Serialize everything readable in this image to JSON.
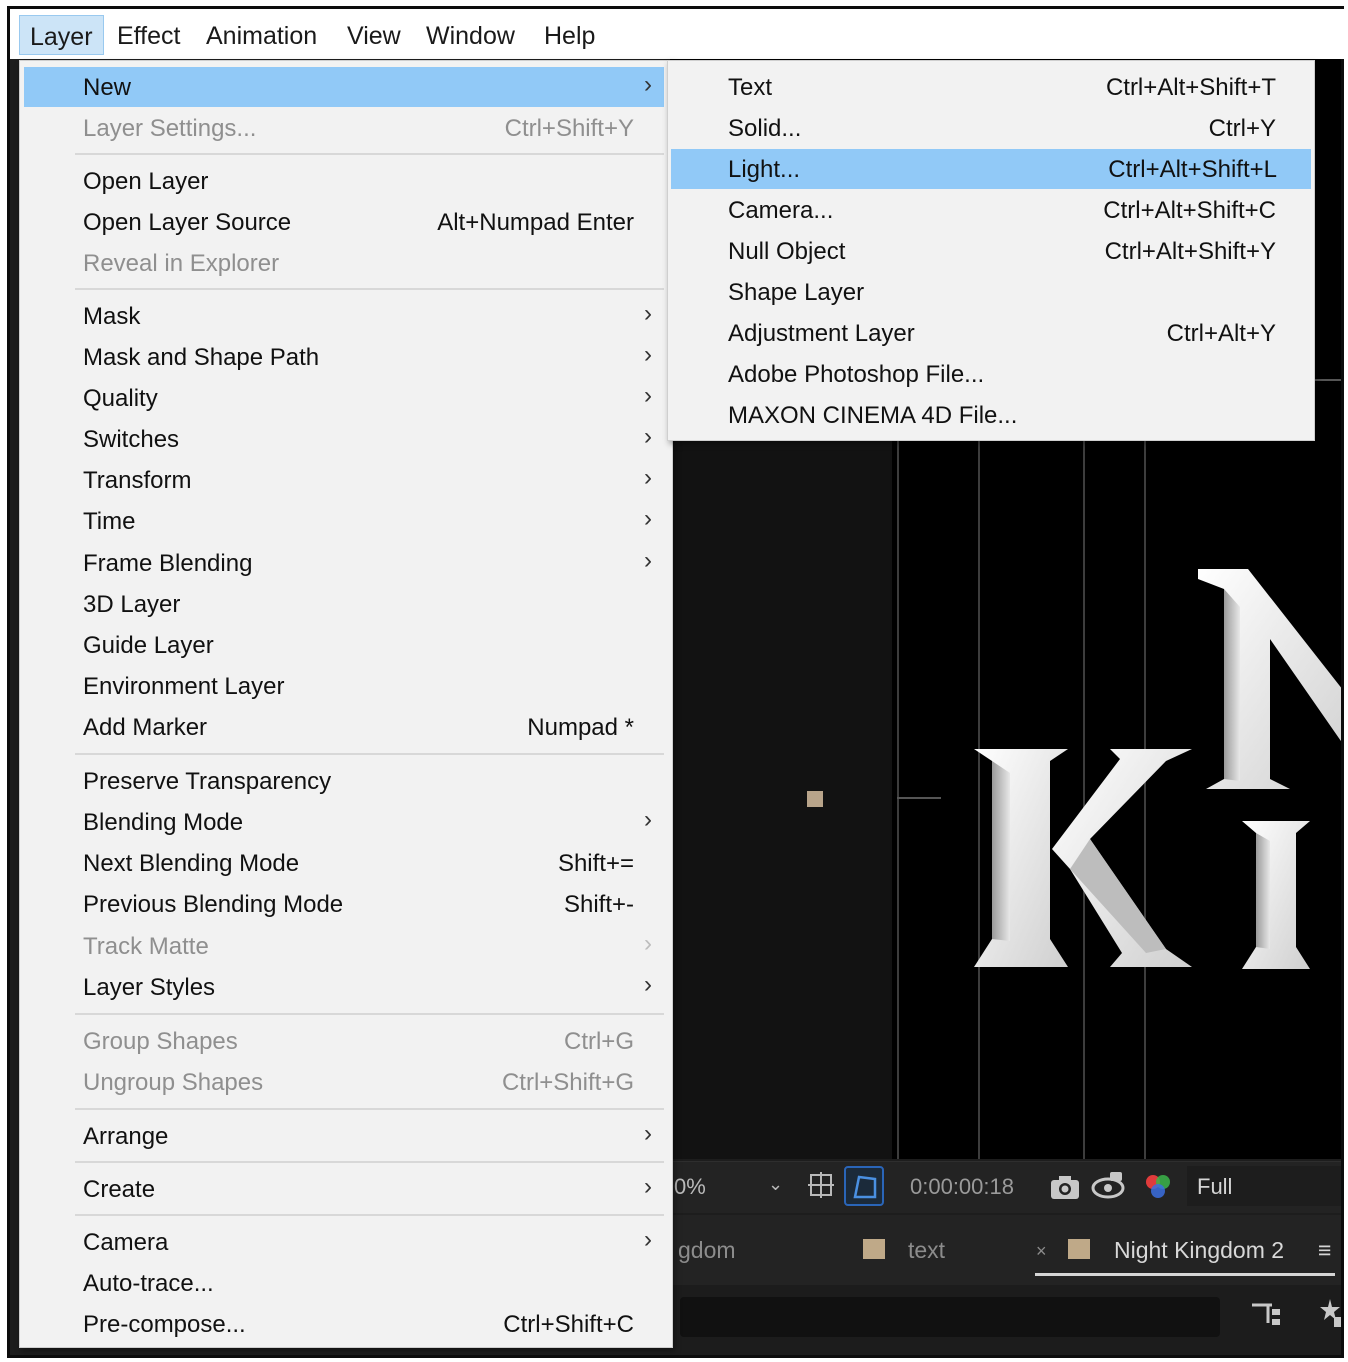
{
  "menubar": {
    "items": [
      "Layer",
      "Effect",
      "Animation",
      "View",
      "Window",
      "Help"
    ],
    "active": "Layer"
  },
  "layer_menu": {
    "items": [
      {
        "label": "New",
        "submenu": true,
        "highlighted": true
      },
      {
        "label": "Layer Settings...",
        "shortcut": "Ctrl+Shift+Y",
        "disabled": true
      },
      {
        "label": "Open Layer"
      },
      {
        "label": "Open Layer Source",
        "shortcut": "Alt+Numpad Enter"
      },
      {
        "label": "Reveal in Explorer",
        "disabled": true
      },
      {
        "label": "Mask",
        "submenu": true
      },
      {
        "label": "Mask and Shape Path",
        "submenu": true
      },
      {
        "label": "Quality",
        "submenu": true
      },
      {
        "label": "Switches",
        "submenu": true
      },
      {
        "label": "Transform",
        "submenu": true
      },
      {
        "label": "Time",
        "submenu": true
      },
      {
        "label": "Frame Blending",
        "submenu": true
      },
      {
        "label": "3D Layer"
      },
      {
        "label": "Guide Layer"
      },
      {
        "label": "Environment Layer"
      },
      {
        "label": "Add Marker",
        "shortcut": "Numpad *"
      },
      {
        "label": "Preserve Transparency"
      },
      {
        "label": "Blending Mode",
        "submenu": true
      },
      {
        "label": "Next Blending Mode",
        "shortcut": "Shift+="
      },
      {
        "label": "Previous Blending Mode",
        "shortcut": "Shift+-"
      },
      {
        "label": "Track Matte",
        "submenu": true,
        "disabled": true
      },
      {
        "label": "Layer Styles",
        "submenu": true
      },
      {
        "label": "Group Shapes",
        "shortcut": "Ctrl+G",
        "disabled": true
      },
      {
        "label": "Ungroup Shapes",
        "shortcut": "Ctrl+Shift+G",
        "disabled": true
      },
      {
        "label": "Arrange",
        "submenu": true
      },
      {
        "label": "Create",
        "submenu": true
      },
      {
        "label": "Camera",
        "submenu": true
      },
      {
        "label": "Auto-trace..."
      },
      {
        "label": "Pre-compose...",
        "shortcut": "Ctrl+Shift+C"
      }
    ]
  },
  "new_submenu": {
    "items": [
      {
        "label": "Text",
        "shortcut": "Ctrl+Alt+Shift+T"
      },
      {
        "label": "Solid...",
        "shortcut": "Ctrl+Y"
      },
      {
        "label": "Light...",
        "shortcut": "Ctrl+Alt+Shift+L",
        "highlighted": true
      },
      {
        "label": "Camera...",
        "shortcut": "Ctrl+Alt+Shift+C"
      },
      {
        "label": "Null Object",
        "shortcut": "Ctrl+Alt+Shift+Y"
      },
      {
        "label": "Shape Layer"
      },
      {
        "label": "Adjustment Layer",
        "shortcut": "Ctrl+Alt+Y"
      },
      {
        "label": "Adobe Photoshop File..."
      },
      {
        "label": "MAXON CINEMA 4D File..."
      }
    ]
  },
  "viewer_toolbar": {
    "zoom": "0%",
    "timecode": "0:00:00:18",
    "resolution": "Full"
  },
  "panel_tabs": {
    "tab1": "gdom",
    "tab2": "text",
    "tab3": "Night Kingdom 2",
    "close_glyph": "×",
    "menu_glyph": "≡"
  },
  "colors": {
    "menu_bg": "#f2f2f2",
    "highlight": "#91c9f7",
    "menubar_active": "#cce4f7",
    "disabled_text": "#8f8f8f",
    "swatch": "#bfa988",
    "toggle_accent": "#2a65b8"
  },
  "icons": [
    "chevron-right-icon",
    "grid-icon",
    "mask-toggle-icon",
    "camera-snapshot-icon",
    "show-snapshot-icon",
    "color-channel-icon",
    "flowchart-icon",
    "draft-3d-icon",
    "panel-menu-icon",
    "close-icon"
  ]
}
